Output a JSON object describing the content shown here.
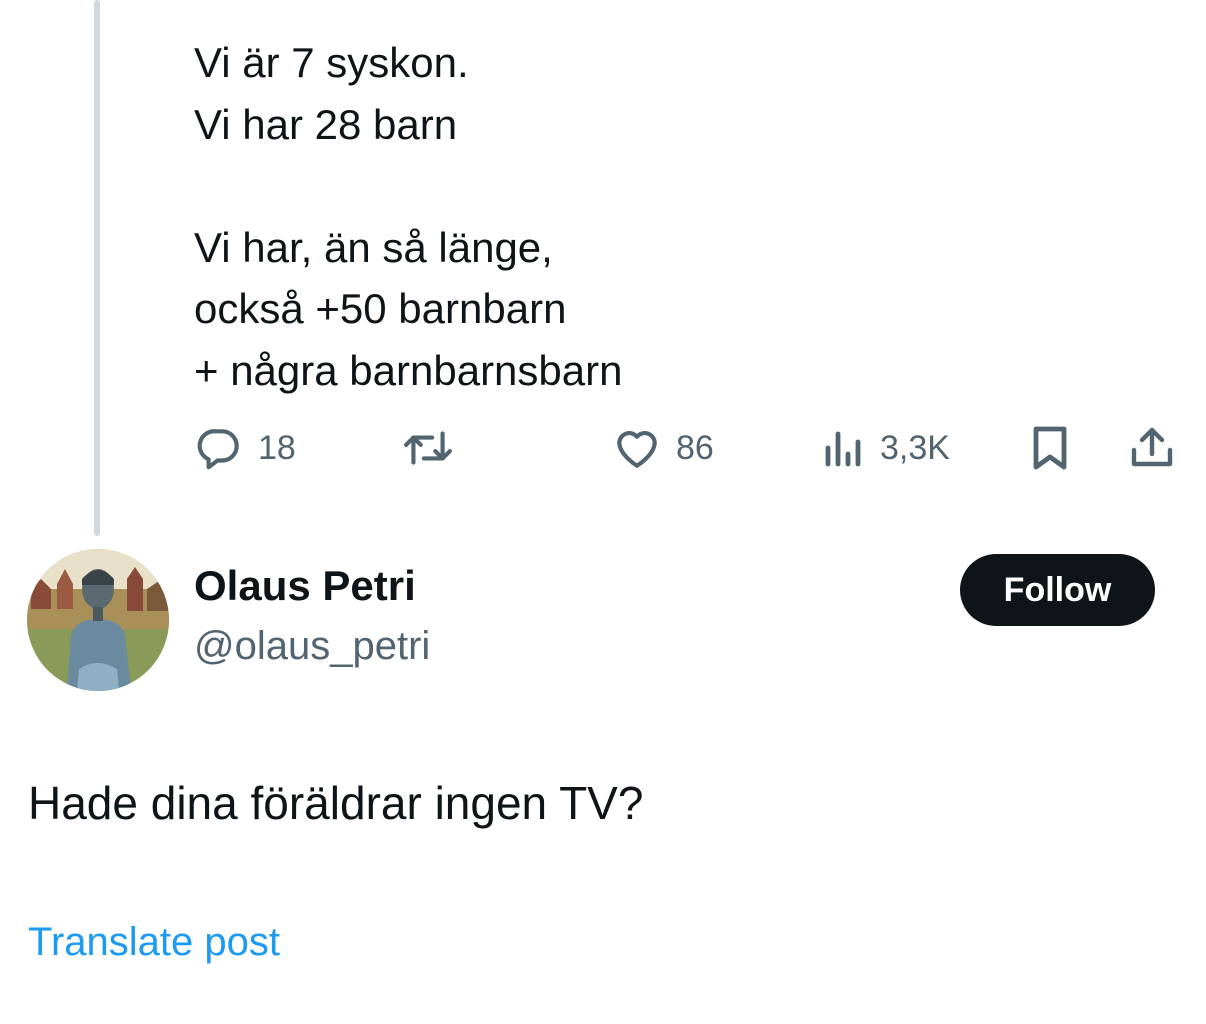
{
  "parent_post": {
    "text": "Vi är 7 syskon.\nVi har 28 barn\n\nVi har, än så länge,\nockså  +50 barnbarn\n+ några barnbarnsbarn",
    "actions": {
      "replies": "18",
      "reposts": "",
      "likes": "86",
      "views": "3,3K"
    }
  },
  "reply_post": {
    "author": {
      "display_name": "Olaus Petri",
      "handle": "@olaus_petri"
    },
    "follow_label": "Follow",
    "text": "Hade dina föräldrar ingen TV?",
    "translate_label": "Translate post"
  },
  "icons": {
    "reply": "reply-icon",
    "repost": "repost-icon",
    "like": "heart-icon",
    "views": "views-icon",
    "bookmark": "bookmark-icon",
    "share": "share-icon"
  },
  "colors": {
    "text": "#0f1419",
    "secondary": "#536471",
    "link": "#1d9bf0",
    "thread_line": "#cfd9de",
    "follow_bg": "#0f1419"
  }
}
